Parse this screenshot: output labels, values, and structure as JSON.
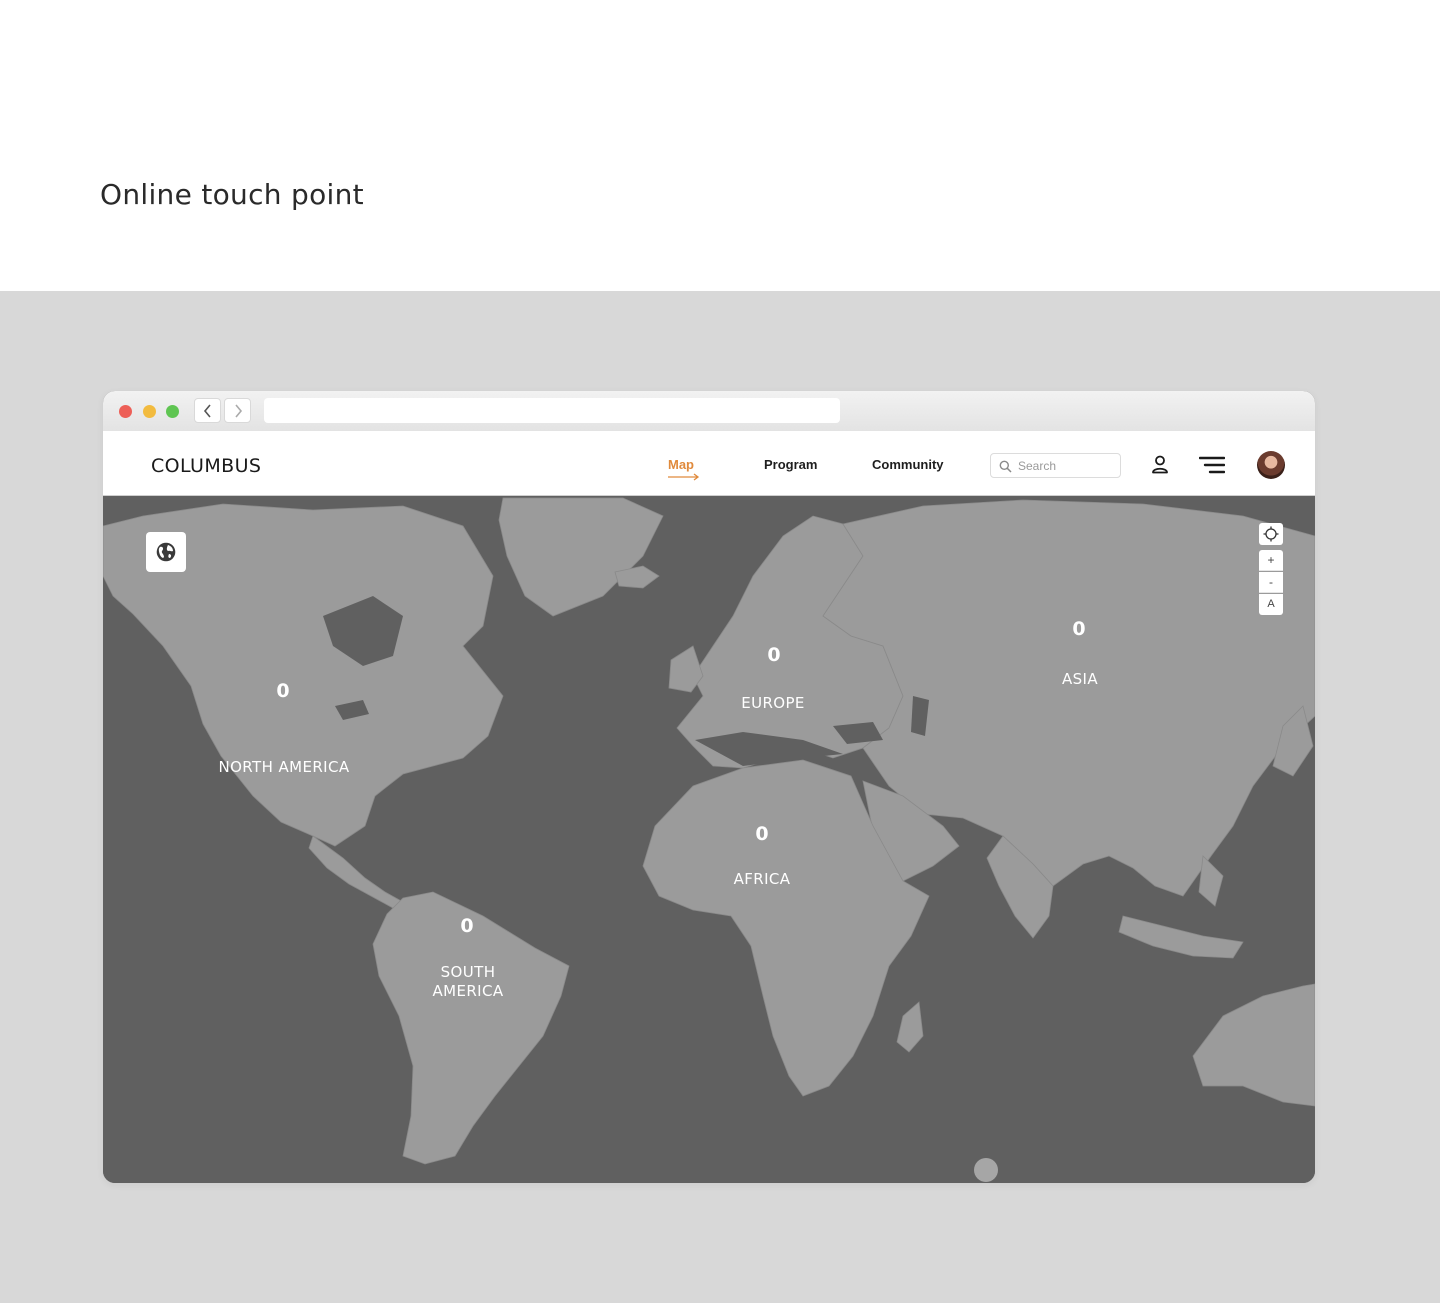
{
  "page": {
    "heading": "Online touch point"
  },
  "app": {
    "logo": "COLUMBUS",
    "nav": {
      "map": "Map",
      "program": "Program",
      "community": "Community"
    },
    "search": {
      "placeholder": "Search"
    },
    "icons": [
      "user-icon",
      "menu-icon",
      "avatar"
    ]
  },
  "map": {
    "controls": {
      "zoom_in": "+",
      "zoom_out": "-",
      "reset": "A"
    },
    "regions": [
      {
        "name": "NORTH AMERICA",
        "count": "0"
      },
      {
        "name": "SOUTH\nAMERICA",
        "count": "0"
      },
      {
        "name": "EUROPE",
        "count": "0"
      },
      {
        "name": "AFRICA",
        "count": "0"
      },
      {
        "name": "ASIA",
        "count": "0"
      }
    ]
  },
  "colors": {
    "accent": "#e08a3c",
    "land": "#9b9b9b",
    "water": "#606060",
    "section_bg": "#d8d8d8"
  }
}
